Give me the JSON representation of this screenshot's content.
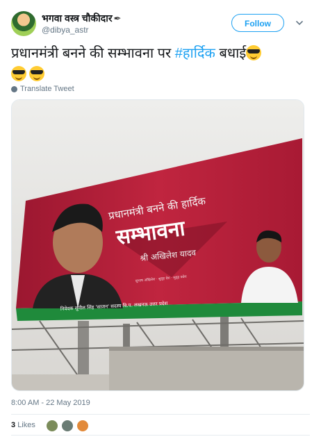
{
  "user": {
    "display_name": "भगवा वस्त्र चौकीदार",
    "handle": "@dibya_astr",
    "pen_icon": "✒"
  },
  "actions": {
    "follow_label": "Follow"
  },
  "tweet": {
    "text_before": "प्रधानमंत्री बनने की सम्भावना पर ",
    "hashtag": "#हार्दिक",
    "text_after": " बधाई",
    "translate_label": "Translate Tweet"
  },
  "billboard": {
    "line1": "प्रधानमंत्री बनने की हार्दिक",
    "line2": "सम्भावना",
    "line3": "श्री अखिलेश यादव",
    "small_line": "सुभाष अखिलेश · सुदृढ़ देश · सुदृढ़ प्रदेश",
    "bottom_strip": "निवेदक   सुनील सिंह 'साजन'   सदस्य वि.प. लखनऊ   उत्तर प्रदेश"
  },
  "meta": {
    "timestamp": "8:00 AM - 22 May 2019",
    "likes_count": "3",
    "likes_label": "Likes"
  },
  "colors": {
    "link": "#1da1f2",
    "secondary": "#657786",
    "board_red": "#b51d3a",
    "board_green": "#1f8a3b"
  }
}
